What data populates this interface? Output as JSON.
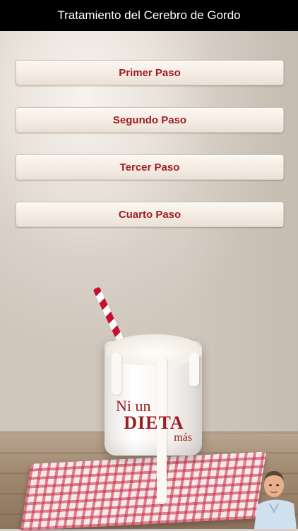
{
  "header": {
    "title": "Tratamiento del Cerebro de Gordo"
  },
  "menu": {
    "buttons": [
      {
        "label": "Primer Paso"
      },
      {
        "label": "Segundo Paso"
      },
      {
        "label": "Tercer Paso"
      },
      {
        "label": "Cuarto Paso"
      }
    ]
  },
  "background": {
    "glass_text": {
      "line1": "Ni un",
      "line2": "DIETA",
      "line3": "más"
    }
  },
  "colors": {
    "accent": "#9f1d24",
    "titlebar": "#000000",
    "button_bg": "#f4ece3"
  }
}
